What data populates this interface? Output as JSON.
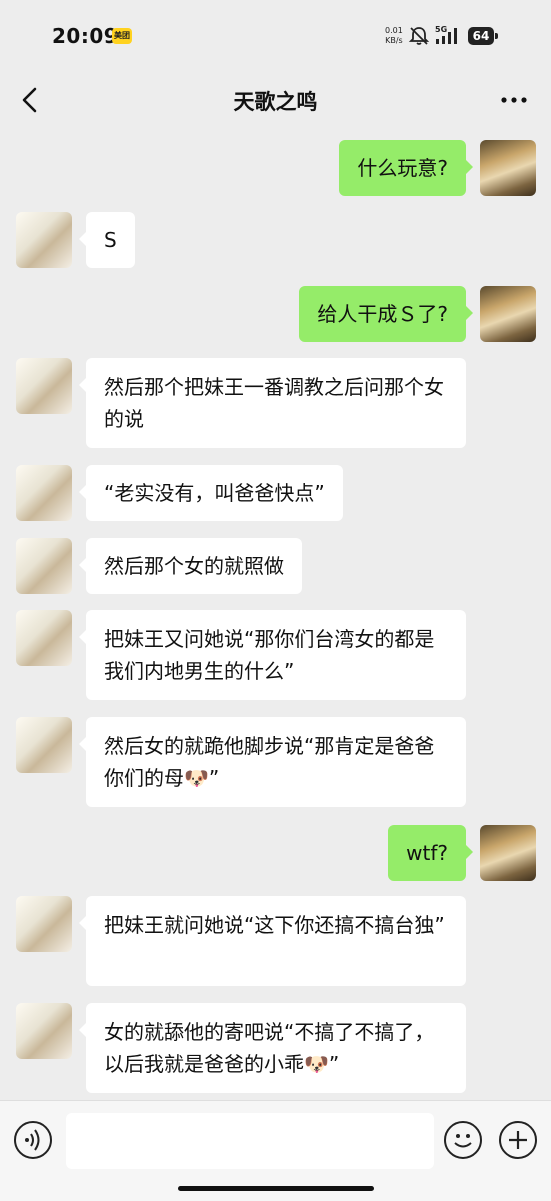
{
  "status_bar": {
    "time": "20:09",
    "app_badge": "美团",
    "net_speed_value": "0.01",
    "net_speed_unit": "KB/s",
    "network": "5G",
    "battery": "64"
  },
  "chat": {
    "title": "天歌之鸣"
  },
  "messages": [
    {
      "sender": "self",
      "text": "什么玩意?"
    },
    {
      "sender": "other",
      "text": "S"
    },
    {
      "sender": "self",
      "text": "给人干成Ｓ了?"
    },
    {
      "sender": "other",
      "text": "然后那个把妹王一番调教之后问那个女的说"
    },
    {
      "sender": "other",
      "text": "“老实没有，叫爸爸快点”"
    },
    {
      "sender": "other",
      "text": "然后那个女的就照做"
    },
    {
      "sender": "other",
      "text": "把妹王又问她说“那你们台湾女的都是我们内地男生的什么”"
    },
    {
      "sender": "other",
      "text": "然后女的就跪他脚步说“那肯定是爸爸你们的母🐶”"
    },
    {
      "sender": "self",
      "text": "wtf?"
    },
    {
      "sender": "other",
      "text": "把妹王就问她说“这下你还搞不搞台独”"
    },
    {
      "sender": "other",
      "text": "女的就舔他的寄吧说“不搞了不搞了，以后我就是爸爸的小乖🐶”"
    }
  ],
  "input": {
    "placeholder": ""
  },
  "icons": {
    "back": "back-chevron-icon",
    "more": "more-dots-icon",
    "voice": "voice-icon",
    "emoji": "emoji-icon",
    "plus": "plus-icon"
  },
  "colors": {
    "background": "#ededed",
    "outgoing_bubble": "#95ec69",
    "incoming_bubble": "#ffffff"
  }
}
